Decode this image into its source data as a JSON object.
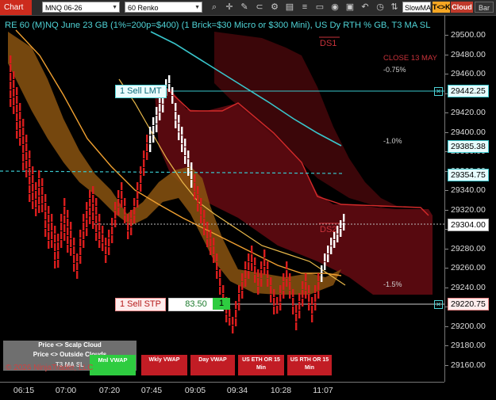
{
  "toolbar": {
    "tab": "Chart",
    "instrument": "MNQ 06-26",
    "bar_type": "60 Renko",
    "slow_ma": "SlowMA",
    "tck_btn": "T<>K",
    "cloud_btn": "Cloud",
    "bar_btn": "Bar",
    "icons": [
      "search-icon",
      "crosshair-icon",
      "pencil-icon",
      "magnet-icon",
      "settings-icon",
      "chart-icon",
      "list-icon",
      "window-icon",
      "camera-icon",
      "save-icon",
      "undo-icon",
      "clock-icon",
      "trades-icon"
    ]
  },
  "header": "RE 60 (M)NQ June 23 GB (1%=200p=$400) (1 Brick=$30 Micro or $300 Mini), US Dy RTH % GB, T3 MA SL",
  "labels": {
    "ds1": "DS1",
    "ds2": "DS2",
    "close": "CLOSE 13 MAY",
    "pct1": "-0.75%",
    "pct2": "-1.0%",
    "pct3": "-1.5%"
  },
  "orders": {
    "sell_lmt": "1 Sell LMT",
    "sell_stp": "1 Sell STP",
    "stp_value": "83.50",
    "stp_qty": "1",
    "close_x": "✕"
  },
  "price_axis": {
    "ticks": [
      "29500.00",
      "29480.00",
      "29460.00",
      "29440.00",
      "29420.00",
      "29400.00",
      "29380.00",
      "29360.00",
      "29340.00",
      "29320.00",
      "29300.00",
      "29280.00",
      "29260.00",
      "29240.00",
      "29220.00",
      "29200.00",
      "29180.00",
      "29160.00"
    ],
    "markers": {
      "lmt": "29442.25",
      "ema": "29385.38",
      "dashed": "29354.75",
      "last": "29304.00",
      "stp": "29220.75"
    }
  },
  "time_axis": [
    "06:15",
    "07:00",
    "07:20",
    "07:45",
    "09:05",
    "09:34",
    "10:28",
    "11:07"
  ],
  "bottom": {
    "scalp_cloud": "Price <> Scalp Cloud",
    "outside_clouds": "Price <> Outside Clouds",
    "t3_ma": "T3 MA SL",
    "mnl_vwap": "Mnl VWAP",
    "wkly_vwap": "Wkly VWAP",
    "day_vwap": "Day VWAP",
    "us_eth": "US ETH OR 15 Min",
    "us_rth": "US RTH OR 15 Min",
    "copyright": "© 2026 NinjaTrader, LLC"
  },
  "colors": {
    "accent_cyan": "#4fd3d6",
    "cloud_red": "#6b0a0f",
    "cloud_orange": "#a8651a",
    "bar_red": "#d81d1d",
    "bar_white": "#ffffff"
  }
}
